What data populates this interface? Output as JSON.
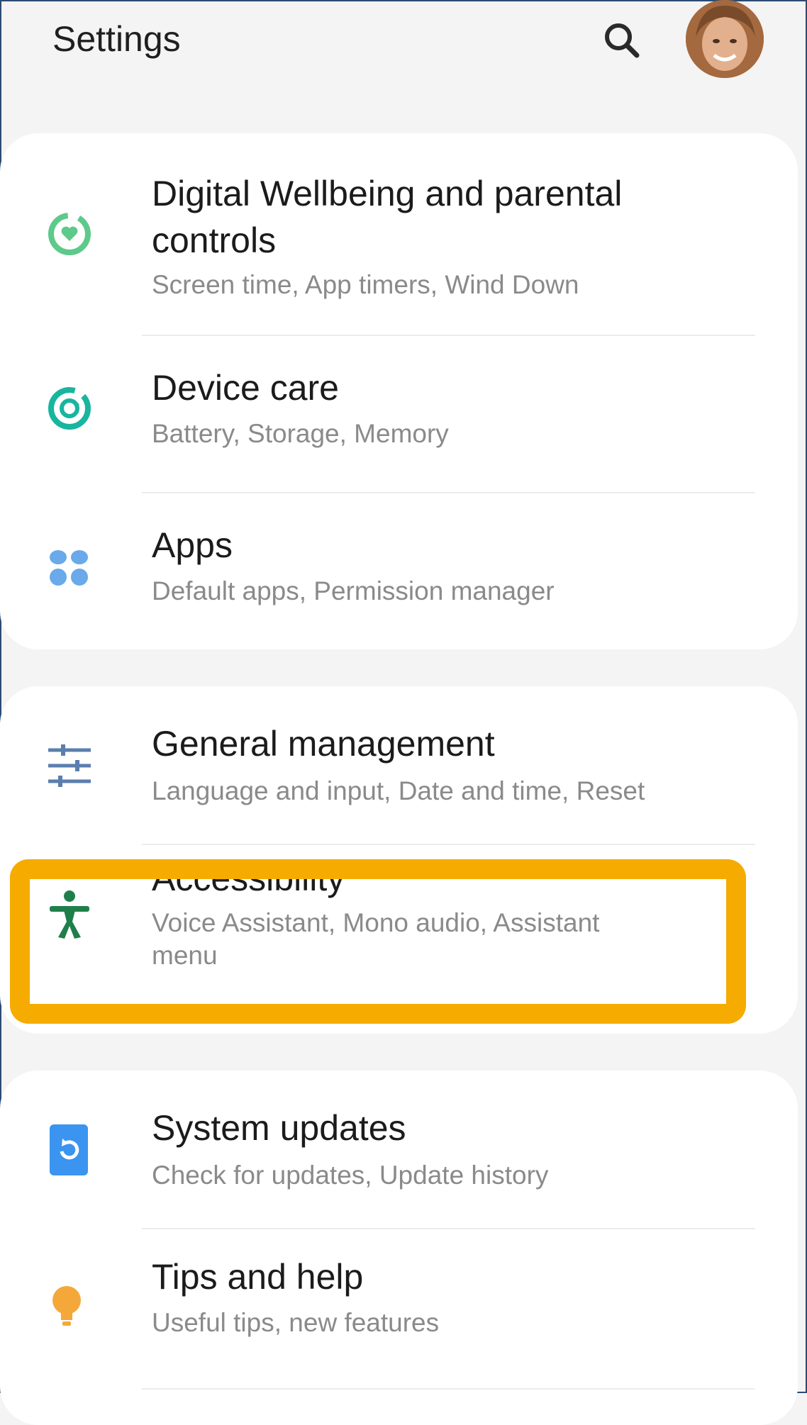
{
  "header": {
    "title": "Settings"
  },
  "items": [
    {
      "title_line1": "Digital Wellbeing and parental",
      "title_line2": "controls",
      "subtitle": "Screen time, App timers, Wind Down"
    },
    {
      "title": "Device care",
      "subtitle": "Battery, Storage, Memory"
    },
    {
      "title": "Apps",
      "subtitle": "Default apps, Permission manager"
    },
    {
      "title": "General management",
      "subtitle": "Language and input, Date and time, Reset"
    },
    {
      "title": "Accessibility",
      "subtitle_line1": "Voice Assistant, Mono audio, Assistant",
      "subtitle_line2": "menu"
    },
    {
      "title": "System updates",
      "subtitle": "Check for updates, Update history"
    },
    {
      "title": "Tips and help",
      "subtitle": "Useful tips, new features"
    }
  ],
  "colors": {
    "highlight": "#f5ab00",
    "wellbeing": "#5dc98a",
    "device_care": "#18b59f",
    "apps": "#6aa9ea",
    "general_management": "#5a7fae",
    "accessibility": "#1f7f4a",
    "system_updates": "#3a94f0",
    "tips": "#f5a83a"
  },
  "icons": {
    "search": "search-icon",
    "avatar": "avatar",
    "wellbeing": "heart-ring-icon",
    "device_care": "refresh-ring-icon",
    "apps": "apps-grid-icon",
    "general_management": "sliders-icon",
    "accessibility": "accessibility-person-icon",
    "system_updates": "update-icon",
    "tips": "lightbulb-icon"
  }
}
